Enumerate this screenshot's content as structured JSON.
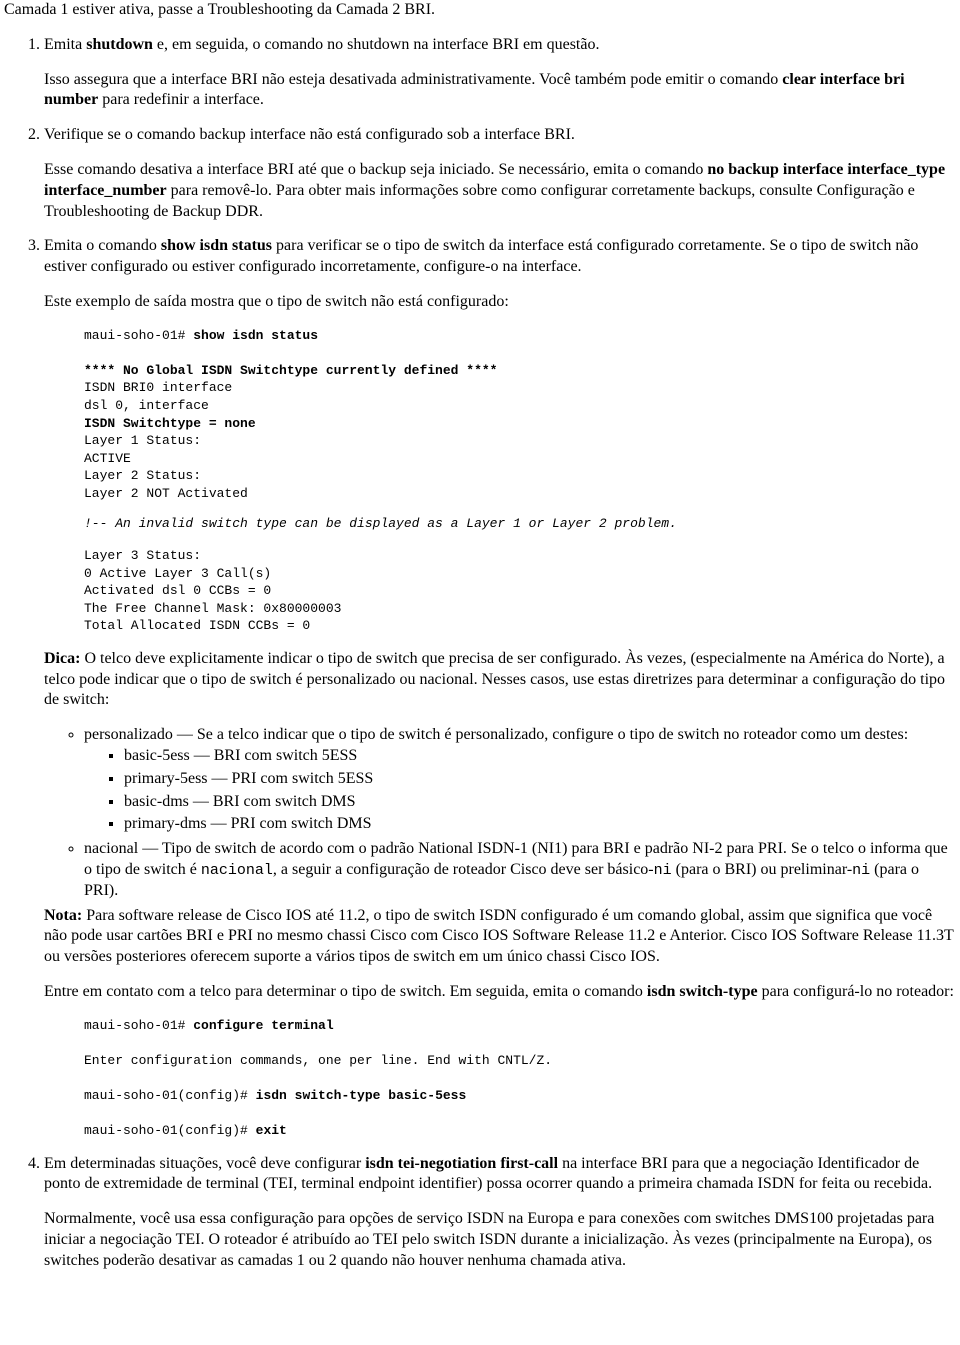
{
  "intro": "Camada 1 estiver ativa, passe a Troubleshooting da Camada 2 BRI.",
  "steps": {
    "s1": {
      "p1a": "Emita ",
      "p1b": "shutdown",
      "p1c": " e, em seguida, o comando no shutdown na interface BRI em questão.",
      "p2a": "Isso assegura que a interface BRI não esteja desativada administrativamente. Você também pode emitir o comando ",
      "p2b": "clear interface bri number",
      "p2c": " para redefinir a interface."
    },
    "s2": {
      "p1": "Verifique se o comando backup interface não está configurado sob a interface BRI.",
      "p2a": "Esse comando desativa a interface BRI até que o backup seja iniciado. Se necessário, emita o comando ",
      "p2b": "no backup interface interface_type interface_number",
      "p2c": " para removê-lo. Para obter mais informações sobre como configurar corretamente backups, consulte Configuração e Troubleshooting de Backup DDR."
    },
    "s3": {
      "p1a": "Emita o comando ",
      "p1b": "show isdn status",
      "p1c": " para verificar se o tipo de switch da interface está configurado corretamente. Se o tipo de switch não estiver configurado ou estiver configurado incorretamente, configure-o na interface.",
      "p2": "Este exemplo de saída mostra que o tipo de switch não está configurado:",
      "code1": {
        "l1": "maui-soho-01# ",
        "l1b": "show isdn status",
        "l2": "",
        "l3": "**** No Global ISDN Switchtype currently defined ****",
        "l4": "ISDN BRI0 interface",
        "l5": "dsl 0, interface",
        "l6": "ISDN Switchtype = none",
        "l7": "Layer 1 Status:",
        "l8": "ACTIVE",
        "l9": "Layer 2 Status:",
        "l10": "Layer 2 NOT Activated"
      },
      "comment": "!-- An invalid switch type can be displayed as a Layer 1 or Layer 2 problem.",
      "code2": {
        "l1": "Layer 3 Status:",
        "l2": "0 Active Layer 3 Call(s)",
        "l3": "Activated dsl 0 CCBs = 0",
        "l4": "The Free Channel Mask: 0x80000003",
        "l5": "Total Allocated ISDN CCBs = 0"
      },
      "dica_label": "Dica:",
      "dica_text": " O telco deve explicitamente indicar o tipo de switch que precisa de ser configurado. Às vezes, (especialmente na América do Norte), a telco pode indicar que o tipo de switch é personalizado ou nacional. Nesses casos, use estas diretrizes para determinar a configuração do tipo de switch:",
      "bullets": {
        "b1": "personalizado — Se a telco indicar que o tipo de switch é personalizado, configure o tipo de switch no roteador como um destes:",
        "sub1": "basic-5ess — BRI com switch 5ESS",
        "sub2": "primary-5ess — PRI com switch 5ESS",
        "sub3": "basic-dms — BRI com switch DMS",
        "sub4": "primary-dms — PRI com switch DMS",
        "b2a": "nacional — Tipo de switch de acordo com o padrão National ISDN-1 (NI1) para BRI e padrão NI-2 para PRI. Se o telco o informa que o tipo de switch é ",
        "b2_code1": "nacional",
        "b2b": ", a seguir a configuração de roteador Cisco deve ser básico-",
        "b2_code2": "ni",
        "b2c": " (para o BRI) ou preliminar-",
        "b2_code3": "ni",
        "b2d": " (para o PRI)."
      },
      "nota_label": "Nota:",
      "nota_text": " Para software release de Cisco IOS até 11.2, o tipo de switch ISDN configurado é um comando global, assim que significa que você não pode usar cartões BRI e PRI no mesmo chassi Cisco com Cisco IOS Software Release 11.2 e Anterior. Cisco IOS Software Release 11.3T ou versões posteriores oferecem suporte a vários tipos de switch em um único chassi Cisco IOS.",
      "p_contact_a": "Entre em contato com a telco para determinar o tipo de switch. Em seguida, emita o comando ",
      "p_contact_b": "isdn switch-type",
      "p_contact_c": " para configurá-lo no roteador:",
      "code3": {
        "l1": "maui-soho-01# ",
        "l1b": "configure terminal",
        "l2": "",
        "l3": "Enter configuration commands, one per line. End with CNTL/Z.",
        "l4": "",
        "l5": "maui-soho-01(config)# ",
        "l5b": "isdn switch-type basic-5ess",
        "l6": "",
        "l7": "maui-soho-01(config)# ",
        "l7b": "exit"
      }
    },
    "s4": {
      "p1a": "Em determinadas situações, você deve configurar ",
      "p1b": "isdn tei-negotiation first-call",
      "p1c": " na interface BRI para que a negociação Identificador de ponto de extremidade de terminal (TEI, terminal endpoint identifier) possa ocorrer quando a primeira chamada ISDN for feita ou recebida.",
      "p2": "Normalmente, você usa essa configuração para opções de serviço ISDN na Europa e para conexões com switches DMS100 projetadas para iniciar a negociação TEI. O roteador é atribuído ao TEI pelo switch ISDN durante a inicialização. Às vezes (principalmente na Europa), os switches poderão desativar as camadas 1 ou 2 quando não houver nenhuma chamada ativa."
    }
  }
}
